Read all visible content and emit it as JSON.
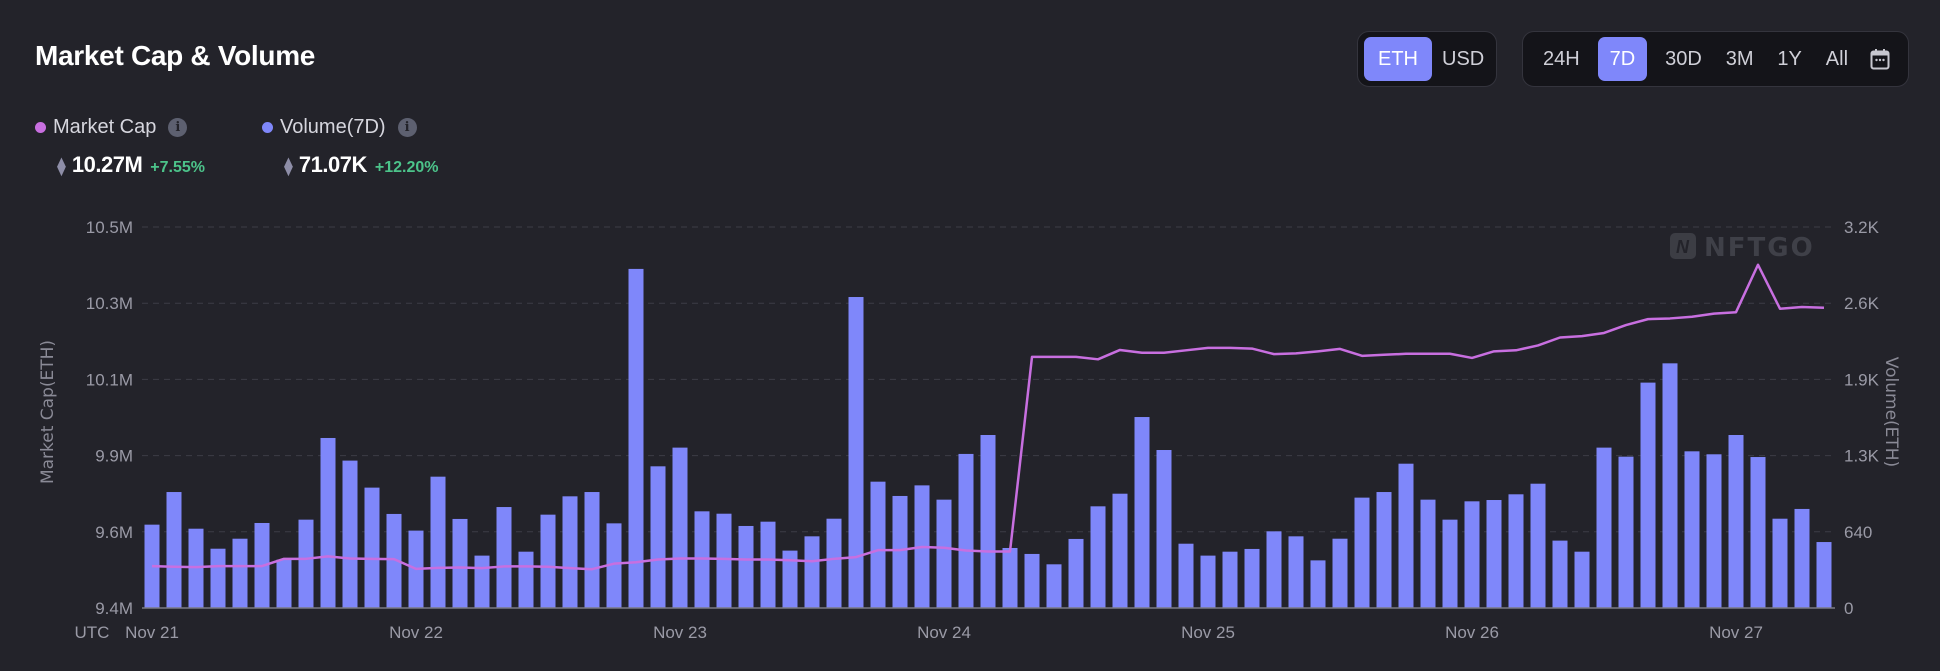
{
  "header": {
    "title": "Market Cap & Volume"
  },
  "legend": [
    {
      "label": "Market Cap",
      "value": "10.27M",
      "change": "+7.55%",
      "color": "#c86fe0",
      "icon": "info-icon",
      "unit_icon": "ethereum-icon"
    },
    {
      "label": "Volume(7D)",
      "value": "71.07K",
      "change": "+12.20%",
      "color": "#7f87fa",
      "icon": "info-icon",
      "unit_icon": "ethereum-icon"
    }
  ],
  "currency_toggle": {
    "options": [
      "ETH",
      "USD"
    ],
    "selected": "ETH"
  },
  "range_toggle": {
    "options": [
      "24H",
      "7D",
      "30D",
      "3M",
      "1Y",
      "All"
    ],
    "selected": "7D",
    "calendar_icon": "calendar-icon"
  },
  "watermark": "NFTGO",
  "colors": {
    "background": "#23232a",
    "accent": "#7f87fa",
    "market_cap_line": "#c86fe0",
    "positive": "#4cc38a"
  },
  "chart_data": {
    "type": "bar+line",
    "timezone_label": "UTC",
    "x_interval": "2 hours",
    "x_tick_labels": [
      "Nov 21",
      "Nov 22",
      "Nov 23",
      "Nov 24",
      "Nov 25",
      "Nov 26",
      "Nov 27"
    ],
    "y_left": {
      "label": "Market Cap(ETH)",
      "ticks": [
        "9.4M",
        "9.6M",
        "9.9M",
        "10.1M",
        "10.3M",
        "10.5M"
      ],
      "range": [
        9.4,
        10.5
      ],
      "unit": "M"
    },
    "y_right": {
      "label": "Volume(ETH)",
      "ticks": [
        "0",
        "640",
        "1.3K",
        "1.9K",
        "2.6K",
        "3.2K"
      ],
      "range": [
        0,
        3200
      ]
    },
    "grid": true,
    "series": [
      {
        "name": "Volume(7D)",
        "type": "bar",
        "axis": "right",
        "values": [
          700,
          974,
          666,
          498,
          582,
          714,
          406,
          742,
          1428,
          1238,
          1011,
          790,
          650,
          1103,
          748,
          440,
          848,
          473,
          784,
          938,
          974,
          711,
          2848,
          1190,
          1347,
          812,
          792,
          689,
          725,
          482,
          602,
          750,
          2612,
          1061,
          941,
          1030,
          910,
          1294,
          1453,
          504,
          454,
          367,
          580,
          854,
          960,
          1604,
          1327,
          540,
          440,
          473,
          496,
          644,
          602,
          400,
          582,
          927,
          974,
          1212,
          910,
          742,
          896,
          907,
          955,
          1044,
          566,
          473,
          1347,
          1271,
          1893,
          2055,
          1316,
          1291,
          1453,
          1268,
          750,
          832,
          554
        ]
      },
      {
        "name": "Market Cap",
        "type": "line",
        "axis": "left",
        "values": [
          9.521,
          9.519,
          9.518,
          9.521,
          9.521,
          9.521,
          9.542,
          9.542,
          9.549,
          9.543,
          9.542,
          9.541,
          9.513,
          9.516,
          9.517,
          9.515,
          9.52,
          9.52,
          9.519,
          9.515,
          9.512,
          9.528,
          9.532,
          9.54,
          9.543,
          9.543,
          9.542,
          9.54,
          9.54,
          9.538,
          9.535,
          9.542,
          9.547,
          9.567,
          9.567,
          9.576,
          9.574,
          9.566,
          9.563,
          9.563,
          10.125,
          10.125,
          10.125,
          10.118,
          10.145,
          10.137,
          10.137,
          10.144,
          10.151,
          10.151,
          10.149,
          10.133,
          10.135,
          10.141,
          10.148,
          10.128,
          10.131,
          10.134,
          10.134,
          10.134,
          10.122,
          10.141,
          10.144,
          10.158,
          10.181,
          10.185,
          10.194,
          10.217,
          10.234,
          10.236,
          10.241,
          10.25,
          10.254,
          10.391,
          10.264,
          10.269,
          10.267
        ]
      }
    ]
  }
}
